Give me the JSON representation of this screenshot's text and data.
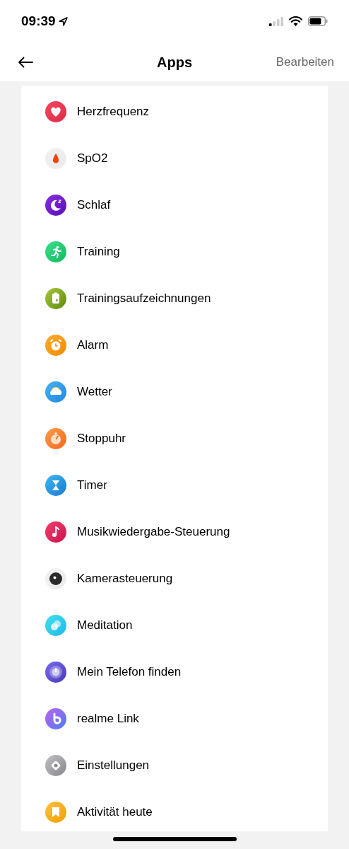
{
  "status_bar": {
    "time": "09:39"
  },
  "nav": {
    "title": "Apps",
    "action": "Bearbeiten"
  },
  "apps": [
    {
      "label": "Herzfrequenz"
    },
    {
      "label": "SpO2"
    },
    {
      "label": "Schlaf"
    },
    {
      "label": "Training"
    },
    {
      "label": "Trainingsaufzeichnungen"
    },
    {
      "label": "Alarm"
    },
    {
      "label": "Wetter"
    },
    {
      "label": "Stoppuhr"
    },
    {
      "label": "Timer"
    },
    {
      "label": "Musikwiedergabe-Steuerung"
    },
    {
      "label": "Kamerasteuerung"
    },
    {
      "label": "Meditation"
    },
    {
      "label": "Mein Telefon finden"
    },
    {
      "label": "realme Link"
    },
    {
      "label": "Einstellungen"
    },
    {
      "label": "Aktivität heute"
    }
  ]
}
